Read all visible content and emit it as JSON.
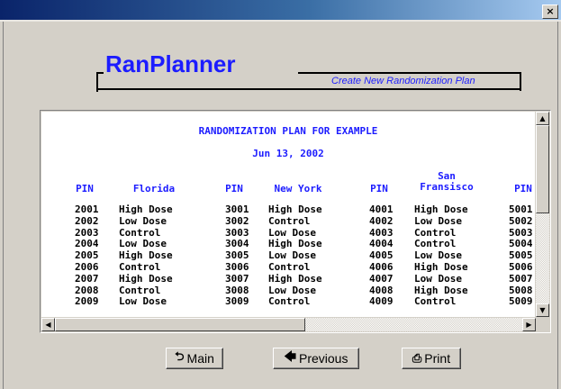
{
  "window": {
    "close_glyph": "×"
  },
  "logo": {
    "title": "RanPlanner",
    "subtitle": "Create New Randomization Plan"
  },
  "report": {
    "title": "RANDOMIZATION PLAN FOR EXAMPLE",
    "date": "Jun 13, 2002",
    "headers": [
      "PIN",
      "Florida",
      "PIN",
      "New York",
      "PIN",
      "San\nFransisco",
      "PIN"
    ],
    "pin_florida": [
      "2001",
      "2002",
      "2003",
      "2004",
      "2005",
      "2006",
      "2007",
      "2008",
      "2009"
    ],
    "florida": [
      "High Dose",
      "Low Dose",
      "Control",
      "Low Dose",
      "High Dose",
      "Control",
      "High Dose",
      "Control",
      "Low Dose"
    ],
    "pin_newyork": [
      "3001",
      "3002",
      "3003",
      "3004",
      "3005",
      "3006",
      "3007",
      "3008",
      "3009"
    ],
    "newyork": [
      "High Dose",
      "Control",
      "Low Dose",
      "High Dose",
      "Low Dose",
      "Control",
      "High Dose",
      "Low Dose",
      "Control"
    ],
    "pin_sanfran": [
      "4001",
      "4002",
      "4003",
      "4004",
      "4005",
      "4006",
      "4007",
      "4008",
      "4009"
    ],
    "sanfran": [
      "High Dose",
      "Low Dose",
      "Control",
      "Control",
      "Low Dose",
      "High Dose",
      "Low Dose",
      "High Dose",
      "Control"
    ],
    "pin_last": [
      "5001",
      "5002",
      "5003",
      "5004",
      "5005",
      "5006",
      "5007",
      "5008",
      "5009"
    ]
  },
  "buttons": {
    "main": {
      "label": "Main",
      "icon": "return-arrow-icon"
    },
    "previous": {
      "label": "Previous",
      "icon": "left-arrow-icon"
    },
    "print": {
      "label": "Print",
      "icon": "printer-icon"
    }
  },
  "colors": {
    "accent": "#1c1cff",
    "titlebar_start": "#0a246a",
    "titlebar_end": "#a6caf0",
    "face": "#d4d0c8"
  }
}
